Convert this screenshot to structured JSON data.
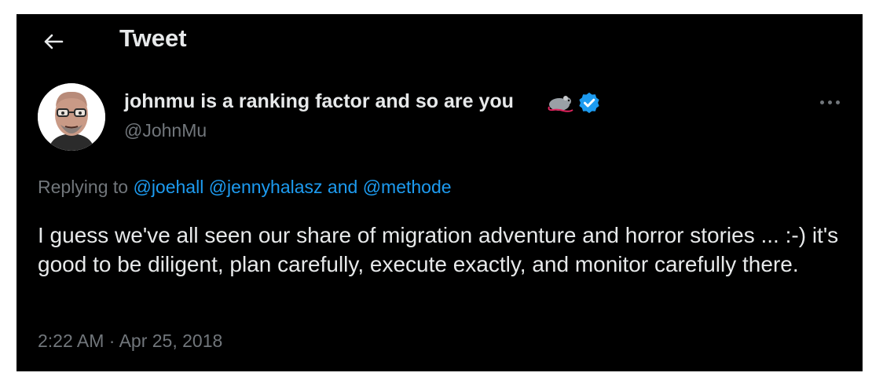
{
  "header": {
    "back_icon": "arrow-left-icon",
    "title": "Tweet"
  },
  "author": {
    "name": "johnmu is a ranking factor and so are you",
    "emoji_icon": "rat-emoji-icon",
    "verified_icon": "verified-badge-icon",
    "handle": "@JohnMu"
  },
  "more_icon": "more-horizontal-icon",
  "reply_context": {
    "prefix": "Replying to",
    "mention_1": "@joehall",
    "mention_2": "@jennyhalasz",
    "conjunction": "and",
    "mention_3": "@methode"
  },
  "tweet": {
    "text": "I guess we've all seen our share of migration adventure and horror stories ... :-) it's good to be diligent, plan carefully, execute exactly, and monitor carefully there."
  },
  "meta": {
    "time": "2:22 AM",
    "separator": "·",
    "date": "Apr 25, 2018"
  },
  "colors": {
    "background": "#000000",
    "text_primary": "#e7e9ea",
    "text_secondary": "#71767b",
    "accent": "#1d9bf0"
  }
}
